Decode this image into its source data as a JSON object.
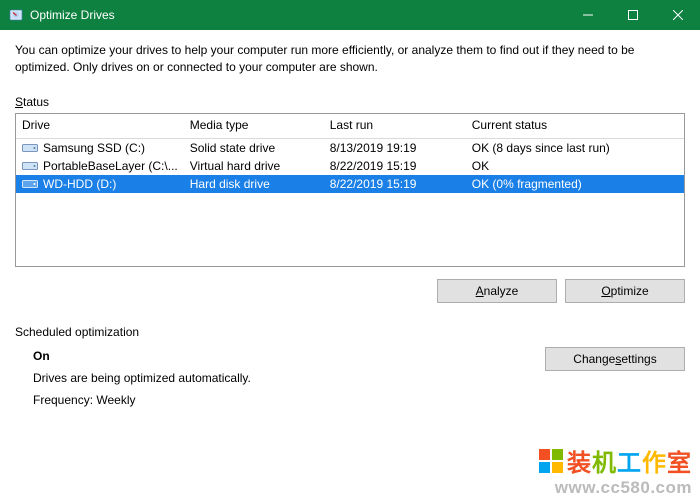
{
  "titlebar": {
    "title": "Optimize Drives"
  },
  "intro": "You can optimize your drives to help your computer run more efficiently, or analyze them to find out if they need to be optimized. Only drives on or connected to your computer are shown.",
  "status_label_pre": "S",
  "status_label_post": "tatus",
  "table": {
    "headers": {
      "drive": "Drive",
      "media": "Media type",
      "last": "Last run",
      "status": "Current status"
    },
    "rows": [
      {
        "drive": "Samsung SSD (C:)",
        "media": "Solid state drive",
        "last": "8/13/2019 19:19",
        "status": "OK (8 days since last run)",
        "selected": false,
        "icon": "ssd"
      },
      {
        "drive": "PortableBaseLayer (C:\\...",
        "media": "Virtual hard drive",
        "last": "8/22/2019 15:19",
        "status": "OK",
        "selected": false,
        "icon": "vhd"
      },
      {
        "drive": "WD-HDD (D:)",
        "media": "Hard disk drive",
        "last": "8/22/2019 15:19",
        "status": "OK (0% fragmented)",
        "selected": true,
        "icon": "hdd"
      }
    ]
  },
  "buttons": {
    "analyze_pre": "",
    "analyze_accel": "A",
    "analyze_post": "nalyze",
    "optimize_pre": "",
    "optimize_accel": "O",
    "optimize_post": "ptimize",
    "change_pre": "Change ",
    "change_accel": "s",
    "change_post": "ettings"
  },
  "scheduled": {
    "label": "Scheduled optimization",
    "on": "On",
    "desc": "Drives are being optimized automatically.",
    "freq": "Frequency: Weekly"
  },
  "watermark": {
    "line1": "装机工作室",
    "line2": "www.cc580.com"
  }
}
